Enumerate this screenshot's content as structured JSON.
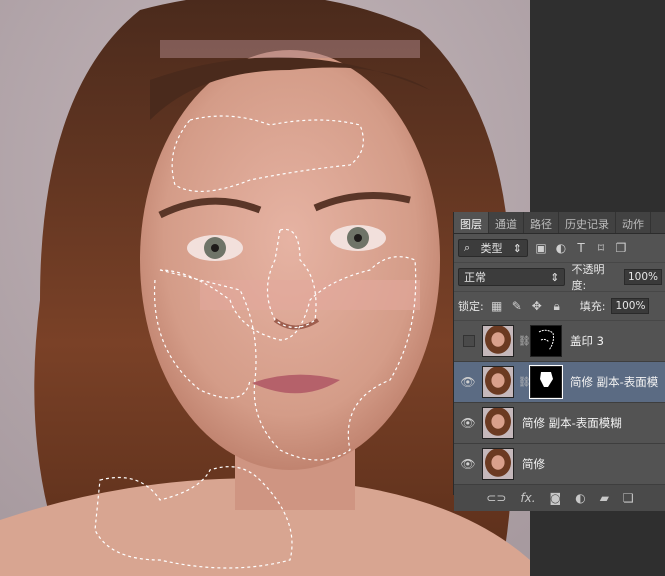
{
  "tabs": [
    "图层",
    "通道",
    "路径",
    "历史记录",
    "动作"
  ],
  "filter": {
    "label": "类型",
    "icons": [
      "image-filter-icon",
      "adjustment-filter-icon",
      "type-filter-icon",
      "shape-filter-icon",
      "smart-object-filter-icon"
    ]
  },
  "blend_mode": "正常",
  "opacity_label": "不透明度:",
  "opacity_value": "100%",
  "lock_label": "锁定:",
  "fill_label": "填充:",
  "fill_value": "100%",
  "layers": [
    {
      "name": "盖印 3",
      "visible": false,
      "has_mask": true
    },
    {
      "name": "简修 副本-表面模",
      "visible": true,
      "has_mask": true,
      "selected": true
    },
    {
      "name": "简修 副本-表面模糊",
      "visible": true,
      "has_mask": false
    },
    {
      "name": "简修",
      "visible": true,
      "has_mask": false
    }
  ],
  "footer_icons": [
    "link-layers-icon",
    "fx-icon",
    "add-mask-icon",
    "adjustment-layer-icon",
    "new-group-icon",
    "new-layer-icon"
  ],
  "footer_fx": "fx."
}
